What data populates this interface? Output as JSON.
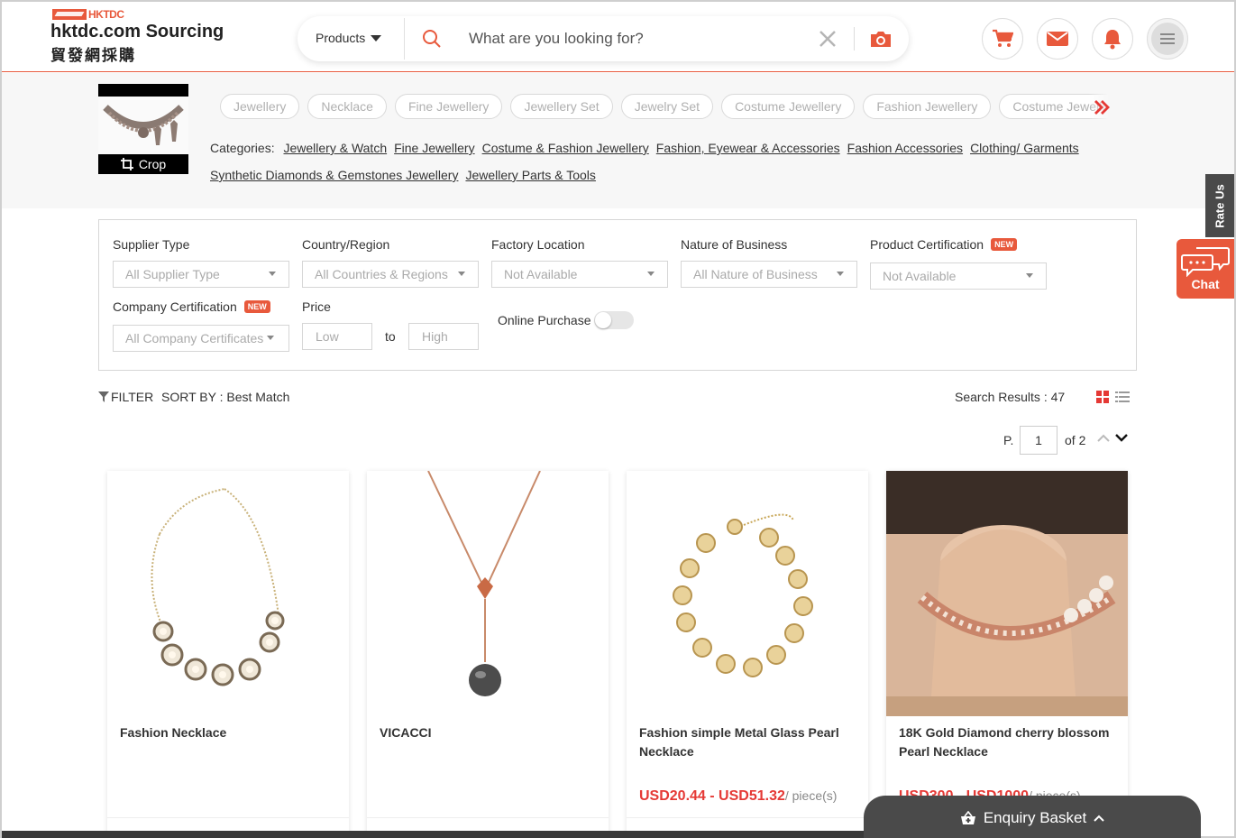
{
  "header": {
    "brand_small": "HKTDC",
    "logo_main": "hktdc.com Sourcing",
    "logo_sub": "貿發網採購",
    "products_label": "Products",
    "search_placeholder": "What are you looking for?"
  },
  "icons": {
    "cart": "cart-icon",
    "mail": "mail-icon",
    "bell": "bell-icon",
    "menu": "menu-icon",
    "search": "search-icon",
    "clear": "close-icon",
    "camera": "camera-icon"
  },
  "accent_color": "#e8593c",
  "price_color": "#e53935",
  "image_search": {
    "crop_label": "Crop"
  },
  "chips": [
    "Jewellery",
    "Necklace",
    "Fine Jewellery",
    "Jewellery Set",
    "Jewelry Set",
    "Costume Jewellery",
    "Fashion Jewellery",
    "Costume Jewellery"
  ],
  "categories": {
    "label": "Categories:",
    "items": [
      "Jewellery & Watch",
      "Fine Jewellery",
      "Costume & Fashion Jewellery",
      "Fashion, Eyewear & Accessories",
      "Fashion Accessories",
      "Clothing/ Garments",
      "Synthetic Diamonds & Gemstones Jewellery",
      "Jewellery Parts & Tools"
    ]
  },
  "filters": {
    "supplier_type": {
      "label": "Supplier Type",
      "value": "All Supplier Type"
    },
    "country": {
      "label": "Country/Region",
      "value": "All Countries & Regions"
    },
    "factory": {
      "label": "Factory Location",
      "value": "Not Available"
    },
    "nature": {
      "label": "Nature of Business",
      "value": "All Nature of Business"
    },
    "product_cert": {
      "label": "Product Certification",
      "value": "Not Available",
      "badge": "NEW"
    },
    "company_cert": {
      "label": "Company Certification",
      "value": "All Company Certificates",
      "badge": "NEW"
    },
    "price": {
      "label": "Price",
      "low": "Low",
      "to": "to",
      "high": "High"
    },
    "online_purchase": {
      "label": "Online Purchase",
      "enabled": false
    }
  },
  "toolbar": {
    "filter_label": "FILTER",
    "sort_label": "SORT BY : Best Match",
    "results_label": "Search Results : 47"
  },
  "pager": {
    "prefix": "P.",
    "current": "1",
    "total": "of 2"
  },
  "products": [
    {
      "name": "Fashion Necklace",
      "price": "",
      "unit": ""
    },
    {
      "name": "VICACCI",
      "price": "",
      "unit": ""
    },
    {
      "name": "Fashion simple Metal Glass Pearl Necklace",
      "price": "USD20.44 - USD51.32",
      "unit": "/ piece(s)"
    },
    {
      "name": "18K Gold Diamond cherry blossom Pearl Necklace",
      "price": "USD300 - USD1000",
      "unit": "/ piece(s)"
    }
  ],
  "side": {
    "rate_us": "Rate Us",
    "chat": "Chat"
  },
  "basket": {
    "label": "Enquiry Basket"
  }
}
